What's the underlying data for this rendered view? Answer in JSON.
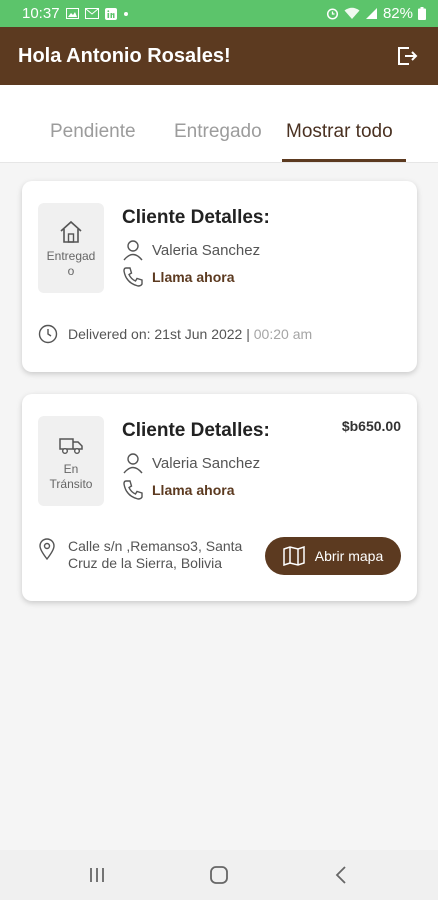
{
  "status_bar": {
    "time": "10:37",
    "battery": "82%"
  },
  "header": {
    "title": "Hola Antonio Rosales!"
  },
  "tabs": [
    {
      "label": "Pendiente"
    },
    {
      "label": "Entregado"
    },
    {
      "label": "Mostrar todo"
    }
  ],
  "orders": [
    {
      "status_line1": "Entregad",
      "status_line2": "o",
      "title": "Cliente Detalles:",
      "client": "Valeria Sanchez",
      "call": "Llama ahora",
      "delivered_prefix": "Delivered on: 21st Jun 2022 | ",
      "delivered_time": "00:20 am"
    },
    {
      "status_line1": "En",
      "status_line2": "Tránsito",
      "title": "Cliente Detalles:",
      "client": "Valeria Sanchez",
      "call": "Llama ahora",
      "price": "$b650.00",
      "address_line1": "Calle s/n ,Remanso3, Santa",
      "address_line2": "Cruz de la Sierra, Bolivia",
      "map_button": "Abrir mapa"
    }
  ],
  "colors": {
    "brand": "#5c3a20",
    "status_bar": "#5cc46b"
  }
}
